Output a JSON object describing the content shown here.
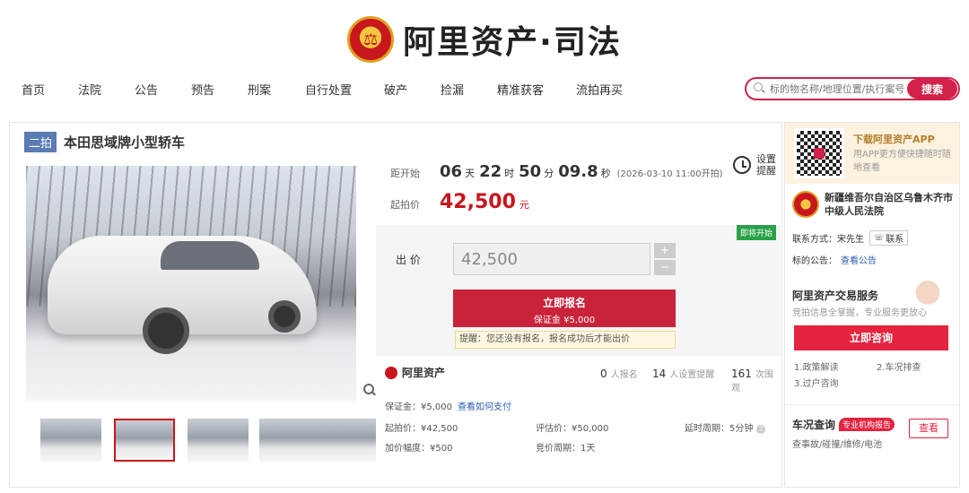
{
  "brand": {
    "title": "阿里资产·司法",
    "emblem_icon": "court-emblem-icon"
  },
  "nav": {
    "items": [
      "首页",
      "法院",
      "公告",
      "预告",
      "刑案",
      "自行处置",
      "破产",
      "捡漏",
      "精准获客",
      "流拍再买"
    ]
  },
  "search": {
    "placeholder": "标的物名称/地理位置/执行案号",
    "button_label": "搜索"
  },
  "item": {
    "round_badge": "二拍",
    "title": "本田思域牌小型轿车"
  },
  "countdown": {
    "label": "距开始",
    "days": "06",
    "days_unit": "天",
    "hours": "22",
    "hours_unit": "时",
    "minutes": "50",
    "minutes_unit": "分",
    "seconds": "09.8",
    "seconds_unit": "秒",
    "start_time": "(2026-03-10 11:00开拍)"
  },
  "remind": {
    "label": "设置提醒"
  },
  "start_price": {
    "label": "起拍价",
    "value": "42,500",
    "unit": "元"
  },
  "bid": {
    "status_badge": "即将开始",
    "label": "出 价",
    "value": "42,500",
    "plus": "+",
    "minus": "−",
    "signup_label": "立即报名",
    "deposit_label": "保证金 ¥5,000",
    "tip": "提醒：您还没有报名，报名成功后才能出价"
  },
  "stats": {
    "brand": "阿里资产",
    "signups": "0",
    "signups_label": "人报名",
    "reminders": "14",
    "reminders_label": "人设置提醒",
    "views": "161",
    "views_label": "次围观"
  },
  "details": {
    "deposit": "保证金：¥5,000",
    "how_to_pay": "查看如何支付",
    "start_price": "起拍价：¥42,500",
    "increment": "加价幅度：¥500",
    "appraisal": "评估价：¥50,000",
    "bid_cycle": "竞价周期：1天",
    "delay_cycle": "延时周期：5分钟"
  },
  "sidebar": {
    "app_title": "下载阿里资产APP",
    "app_sub": "用APP更方便快捷随时随地查看",
    "court_name": "新疆维吾尔自治区乌鲁木齐市中级人民法院",
    "contact_label": "联系方式：宋先生",
    "contact_btn": "联系",
    "notice_label": "标的公告：",
    "notice_link": "查看公告",
    "service_title": "阿里资产交易服务",
    "service_sub": "竞拍信息全掌握，专业服务更放心",
    "consult_btn": "立即咨询",
    "services": [
      "1.政策解读",
      "2.车况排查",
      "3.过户咨询"
    ],
    "vehicle_title": "车况查询",
    "pro_badge": "专业机构报告",
    "vehicle_sub": "查事故/碰撞/维修/电池",
    "check_btn": "查看"
  },
  "colors": {
    "accent": "#c8161d",
    "brand_red": "#d2214a",
    "link": "#2a5cb0",
    "badge_blue": "#5a7bb4",
    "status_green": "#2aa148"
  }
}
